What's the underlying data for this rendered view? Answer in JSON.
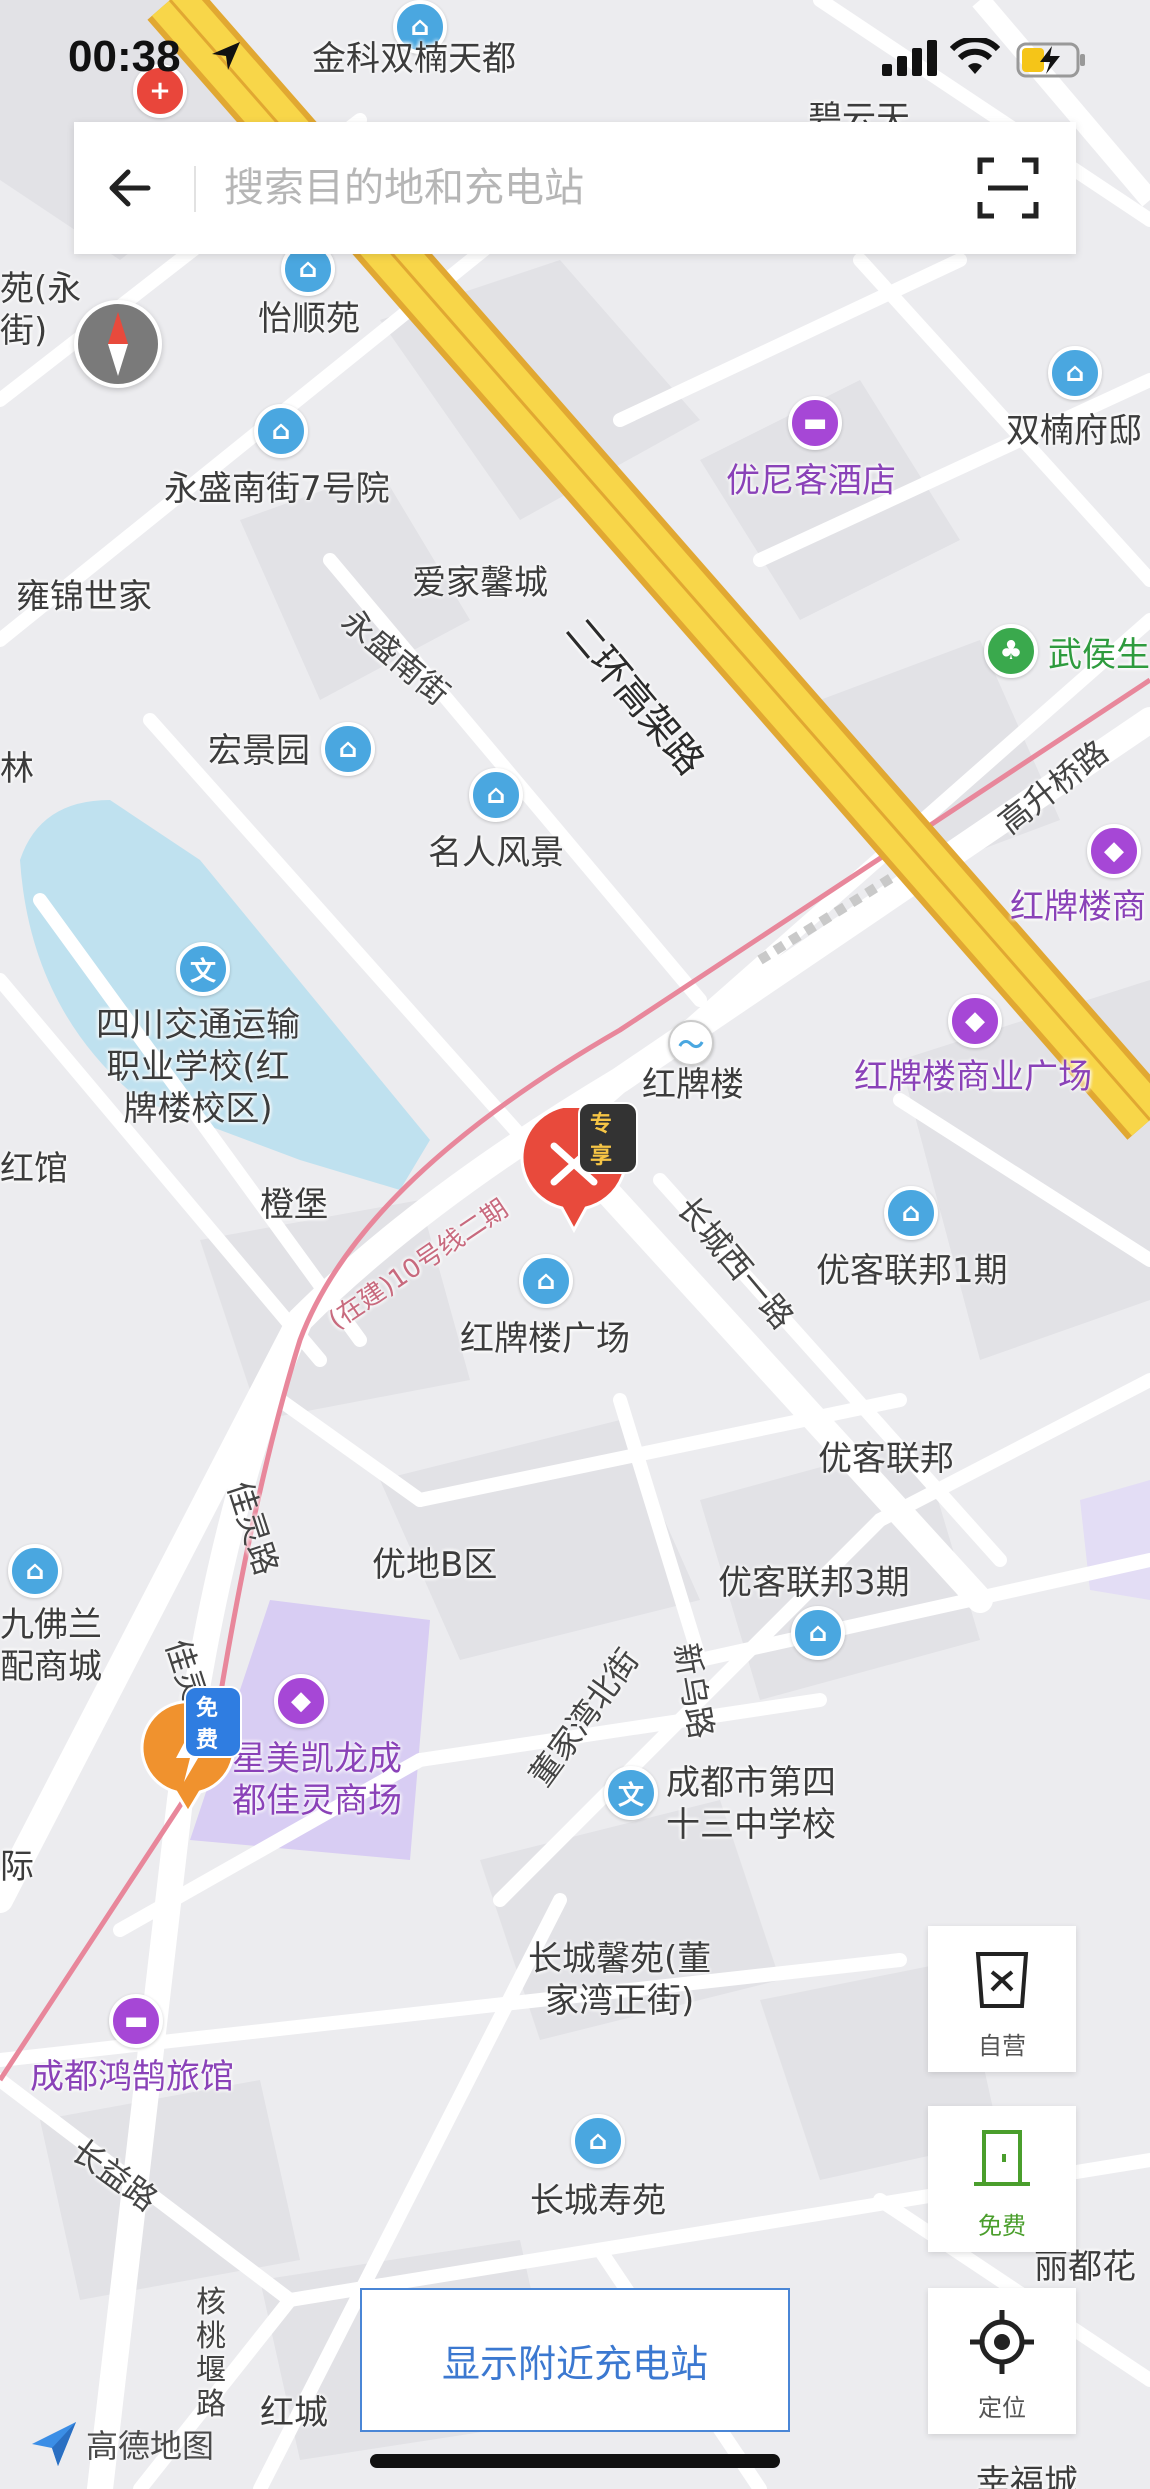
{
  "status_bar": {
    "time": "00:38"
  },
  "search": {
    "placeholder": "搜索目的地和充电站"
  },
  "map_labels": {
    "jinke": "金科双楠天都",
    "biyun": "碧云天",
    "yishunyuan": "怡顺苑",
    "yuan_jie": "苑(永\n街)",
    "shuangnan": "双楠府邸",
    "yongsheng7": "永盛南街7号院",
    "youni": "优尼客酒店",
    "erhuan": "二环高架路",
    "aijia": "爱家馨城",
    "yongjin": "雍锦世家",
    "yongshengnanjie": "永盛南街",
    "wuhou": "武侯生",
    "lin": "林",
    "hongjing": "宏景园",
    "gaosheng": "高升桥路",
    "mingren": "名人风景",
    "hongpai_shang": "红牌楼商",
    "sichuan": "四川交通运输\n职业学校(红\n牌楼校区)",
    "hongpailou": "红牌楼",
    "hongpai_plaza": "红牌楼商业广场",
    "hongguan": "红馆",
    "chengbao": "橙堡",
    "line10": "(在建)10号线二期",
    "changcheng_west": "长城西一路",
    "youke1": "优客联邦1期",
    "hongpai_guangchang": "红牌楼广场",
    "youkelianbang": "优客联邦",
    "jialing": "佳灵路",
    "youdi": "优地B区",
    "youke3": "优客联邦3期",
    "jiufo": "九佛兰\n配商城",
    "jialingnan": "佳灵南路",
    "xingmei": "星美凯龙成\n都佳灵商场",
    "dongjia_north": "董家湾北街",
    "xinwu": "新乌路",
    "school43": "成都市第四\n十三中学校",
    "ji": "际",
    "changcheng_xinyuan": "长城馨苑(董\n家湾正街)",
    "honghu": "成都鸿鹄旅馆",
    "changyi": "长益路",
    "changcheng_shou": "长城寿苑",
    "hetao": "核\n桃\n堰\n路",
    "hongcheng": "红城",
    "lidu": "丽都花",
    "xingfu": "幸福城"
  },
  "markers": {
    "exclusive_badge": "专享",
    "free_badge": "免费"
  },
  "right_buttons": {
    "self_run": "自营",
    "free": "免费",
    "locate": "定位"
  },
  "show_nearby_button": "显示附近充电站",
  "logo_text": "高德地图"
}
